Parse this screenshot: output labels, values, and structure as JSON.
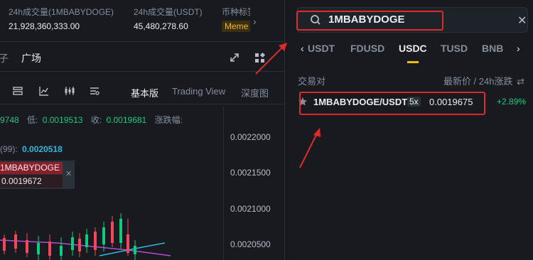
{
  "stats": [
    {
      "label": "24h成交量(1MBABYDOGE)",
      "value": "21,928,360,333.00"
    },
    {
      "label": "24h成交量(USDT)",
      "value": "45,480,278.60"
    },
    {
      "label": "币种标签",
      "value": "Meme"
    }
  ],
  "chart_tabs": {
    "partial": "子",
    "square": "广场"
  },
  "views": [
    "基本版",
    "Trading View",
    "深度图"
  ],
  "ohlc": {
    "high_partial": "9748",
    "low_label": "低:",
    "low_value": "0.0019513",
    "close_label": "收:",
    "close_value": "0.0019681",
    "change_label": "涨跌幅:"
  },
  "ma": {
    "label": "(99):",
    "value": "0.0020518"
  },
  "tooltip": {
    "name": "1MBABYDOGE",
    "price": "0.0019672"
  },
  "price_axis": [
    "0.0022000",
    "0.0021500",
    "0.0021000",
    "0.0020500"
  ],
  "search": {
    "value": "1MBABYDOGE"
  },
  "quote_tabs": [
    "USDT",
    "FDUSD",
    "USDC",
    "TUSD",
    "BNB"
  ],
  "active_quote": "USDC",
  "list": {
    "col_pair": "交易对",
    "col_price": "最新价 / 24h涨跌"
  },
  "result": {
    "symbol": "1MBABYDOGE/USDT",
    "leverage": "5x",
    "price": "0.0019675",
    "change": "+2.89%"
  },
  "colors": {
    "up": "#0ecb81",
    "down": "#f6465d",
    "accent": "#f0b90b",
    "annotation": "#e02a2a"
  }
}
